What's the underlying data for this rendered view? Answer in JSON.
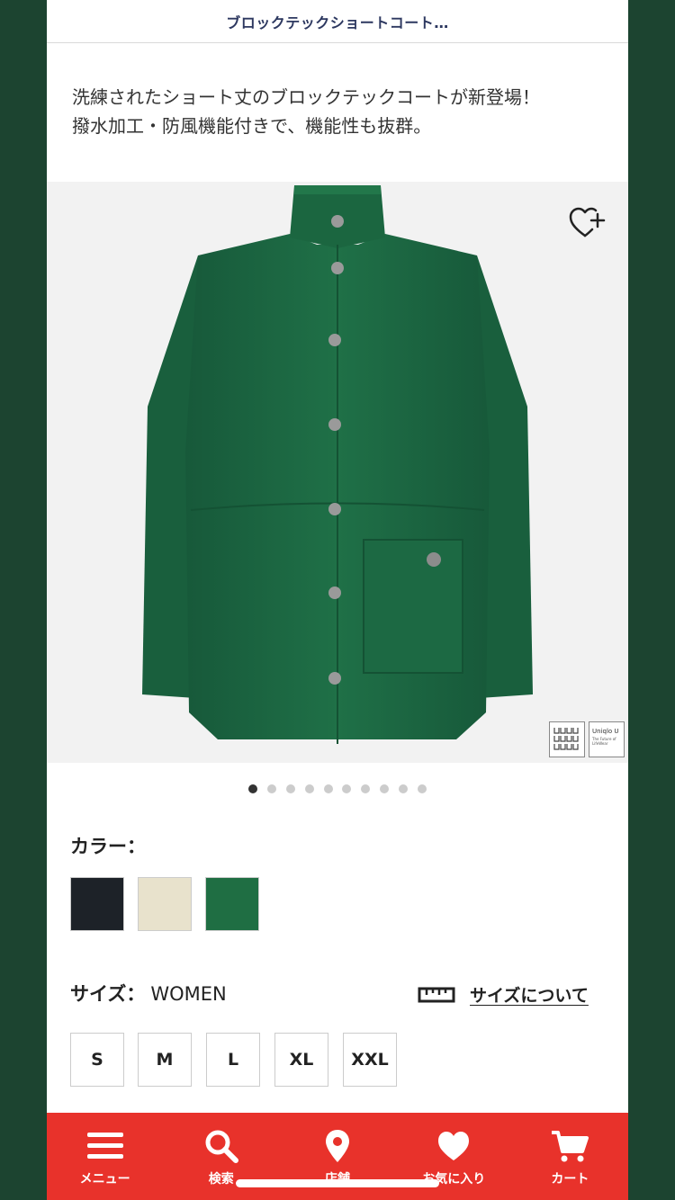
{
  "header": {
    "title": "ブロックテックショートコート…"
  },
  "product": {
    "description_line1": "洗練されたショート丈のブロックテックコートが新登場！",
    "description_line2": "撥水加工・防風機能付きで、機能性も抜群。",
    "image_alt": "green short coat",
    "badge_uniqlo": "Uniqlo U",
    "badge_tagline": "The Future of LifeWear",
    "carousel": {
      "count": 10,
      "active_index": 0
    }
  },
  "color": {
    "label": "カラー：",
    "swatches": [
      {
        "name": "black",
        "hex": "#1d2228"
      },
      {
        "name": "beige",
        "hex": "#e8e2cc"
      },
      {
        "name": "green",
        "hex": "#1f6e43"
      }
    ]
  },
  "size": {
    "label": "サイズ：",
    "value": "WOMEN",
    "guide_link": "サイズについて",
    "options": [
      "S",
      "M",
      "L",
      "XL",
      "XXL"
    ]
  },
  "tabbar": {
    "items": [
      {
        "label": "メニュー",
        "icon": "menu-icon"
      },
      {
        "label": "検索",
        "icon": "search-icon"
      },
      {
        "label": "店舗",
        "icon": "location-pin-icon"
      },
      {
        "label": "お気に入り",
        "icon": "heart-icon"
      },
      {
        "label": "カート",
        "icon": "cart-icon"
      }
    ]
  },
  "colors": {
    "accent": "#e8322b",
    "background": "#1c4430",
    "title": "#2d3860",
    "garment": "#1f6e43"
  }
}
